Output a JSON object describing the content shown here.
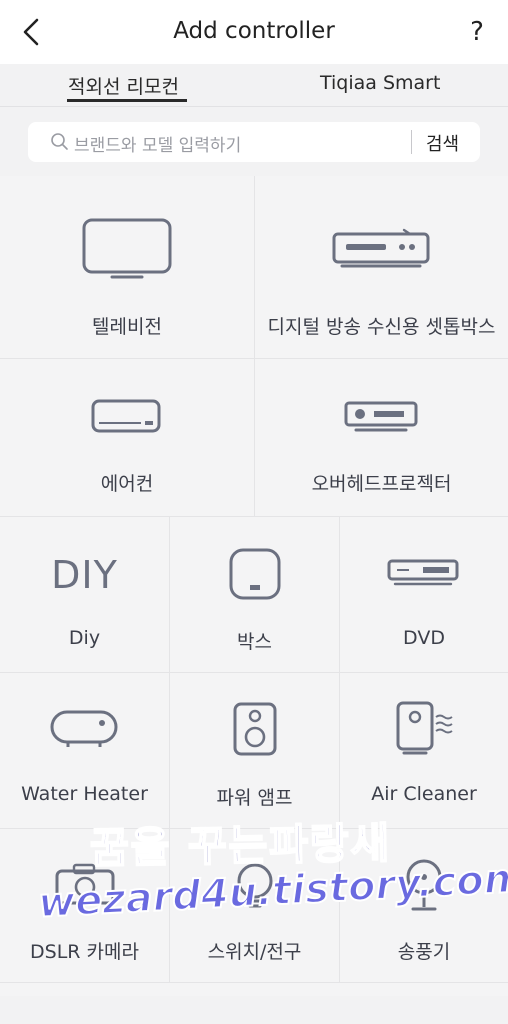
{
  "header": {
    "title": "Add controller",
    "help_label": "?"
  },
  "tabs": [
    {
      "label": "적외선 리모컨",
      "active": true
    },
    {
      "label": "Tiqiaa Smart",
      "active": false
    }
  ],
  "search": {
    "placeholder": "브랜드와 모델 입력하기",
    "button_label": "검색"
  },
  "devices_large": [
    {
      "label": "텔레비전",
      "icon": "tv-icon"
    },
    {
      "label": "디지털 방송 수신용 셋톱박스",
      "icon": "set-top-box-icon"
    },
    {
      "label": "에어컨",
      "icon": "air-conditioner-icon"
    },
    {
      "label": "오버헤드프로젝터",
      "icon": "projector-icon"
    }
  ],
  "devices_small": [
    {
      "label": "Diy",
      "icon": "diy-icon",
      "icon_text": "DIY"
    },
    {
      "label": "박스",
      "icon": "box-icon"
    },
    {
      "label": "DVD",
      "icon": "dvd-icon"
    },
    {
      "label": "Water Heater",
      "icon": "water-heater-icon"
    },
    {
      "label": "파워 앰프",
      "icon": "speaker-icon"
    },
    {
      "label": "Air Cleaner",
      "icon": "air-cleaner-icon"
    },
    {
      "label": "DSLR 카메라",
      "icon": "camera-icon"
    },
    {
      "label": "스위치/전구",
      "icon": "switch-bulb-icon"
    },
    {
      "label": "송풍기",
      "icon": "fan-icon"
    }
  ],
  "watermark": {
    "line1": "꿈을 꾸는파랑새",
    "line2": "wezard4u.tistory.com"
  },
  "colors": {
    "icon_stroke": "#6b7080",
    "background": "#f2f2f3",
    "text": "#3c3f4a"
  }
}
